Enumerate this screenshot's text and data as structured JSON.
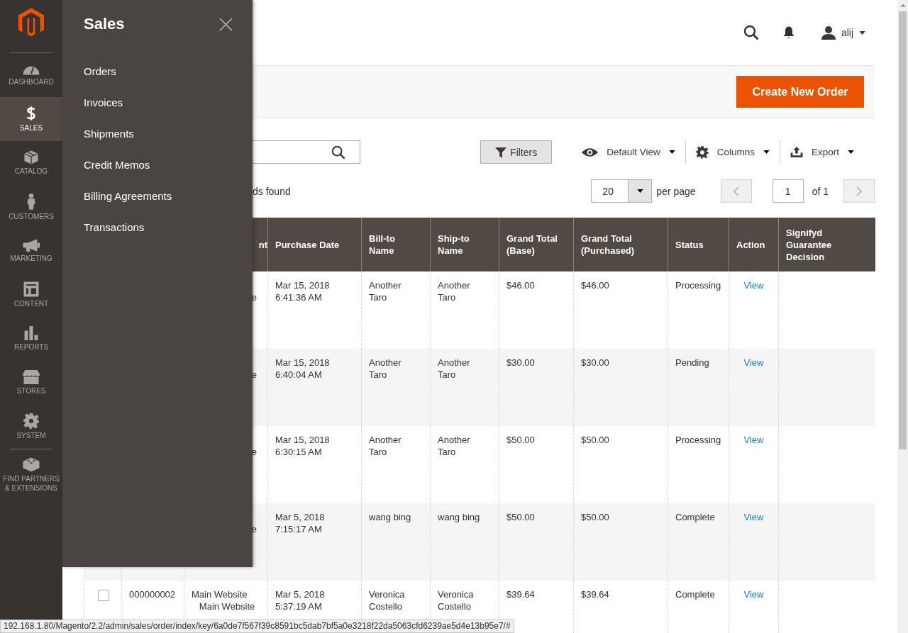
{
  "nav": [
    {
      "label": "DASHBOARD",
      "kind": "dashboard",
      "selected": false
    },
    {
      "label": "SALES",
      "kind": "sales",
      "selected": true
    },
    {
      "label": "CATALOG",
      "kind": "catalog",
      "selected": false
    },
    {
      "label": "CUSTOMERS",
      "kind": "customers",
      "selected": false
    },
    {
      "label": "MARKETING",
      "kind": "marketing",
      "selected": false
    },
    {
      "label": "CONTENT",
      "kind": "content",
      "selected": false
    },
    {
      "label": "REPORTS",
      "kind": "reports",
      "selected": false
    },
    {
      "label": "STORES",
      "kind": "stores",
      "selected": false
    },
    {
      "label": "SYSTEM",
      "kind": "system",
      "selected": false
    },
    {
      "label": "FIND PARTNERS & EXTENSIONS",
      "kind": "partners",
      "selected": false
    }
  ],
  "flyout": {
    "title": "Sales",
    "items": [
      "Orders",
      "Invoices",
      "Shipments",
      "Credit Memos",
      "Billing Agreements",
      "Transactions"
    ]
  },
  "header": {
    "user": "alij"
  },
  "actions": {
    "primary_button": "Create New Order"
  },
  "toolbar": {
    "filters": "Filters",
    "view": "Default View",
    "columns": "Columns",
    "export": "Export",
    "records_found": "ds found",
    "per_page": "20",
    "per_page_label": "per page",
    "page": "1",
    "page_total": "of 1",
    "prev_disabled": true,
    "next_disabled": true
  },
  "table": {
    "columns": [
      "nt",
      "Purchase Date",
      "Bill-to\nName",
      "Ship-to\nName",
      "Grand Total\n(Base)",
      "Grand Total\n(Purchased)",
      "Status",
      "Action",
      "Signifyd\nGuarantee\nDecision"
    ],
    "rows": [
      {
        "kind": "covered",
        "purchase_point": "e",
        "purchase_date": "Mar 15, 2018\n6:41:36 AM",
        "bill_to": "Another\nTaro",
        "ship_to": "Another\nTaro",
        "total_base": "$46.00",
        "total_purchased": "$46.00",
        "status": "Processing",
        "action": "View"
      },
      {
        "kind": "covered",
        "purchase_point": "e",
        "purchase_date": "Mar 15, 2018\n6:40:04 AM",
        "bill_to": "Another\nTaro",
        "ship_to": "Another\nTaro",
        "total_base": "$30.00",
        "total_purchased": "$30.00",
        "status": "Pending",
        "action": "View"
      },
      {
        "kind": "covered",
        "purchase_point": "e",
        "purchase_date": "Mar 15, 2018\n6:30:15 AM",
        "bill_to": "Another\nTaro",
        "ship_to": "Another\nTaro",
        "total_base": "$50.00",
        "total_purchased": "$50.00",
        "status": "Processing",
        "action": "View"
      },
      {
        "kind": "covered",
        "purchase_point": "e",
        "purchase_date": "Mar 5, 2018\n7:15:17 AM",
        "bill_to": "wang bing",
        "ship_to": "wang bing",
        "total_base": "$50.00",
        "total_purchased": "$50.00",
        "status": "Complete",
        "action": "View"
      },
      {
        "kind": "full",
        "checked": false,
        "order_id": "000000002",
        "purchase_point": "Main Website\n   Main Website",
        "purchase_date": "Mar 5, 2018\n5:37:19 AM",
        "bill_to": "Veronica\nCostello",
        "ship_to": "Veronica\nCostello",
        "total_base": "$39.64",
        "total_purchased": "$39.64",
        "status": "Complete",
        "action": "View"
      }
    ]
  },
  "status_bar": "192.168.1.80/Magento/2.2/admin/sales/order/index/key/6a0de7f567f39c8591bc5dab7bf5a0e3218f22da5063cfd6239ae5d4e13b95e7/#"
}
